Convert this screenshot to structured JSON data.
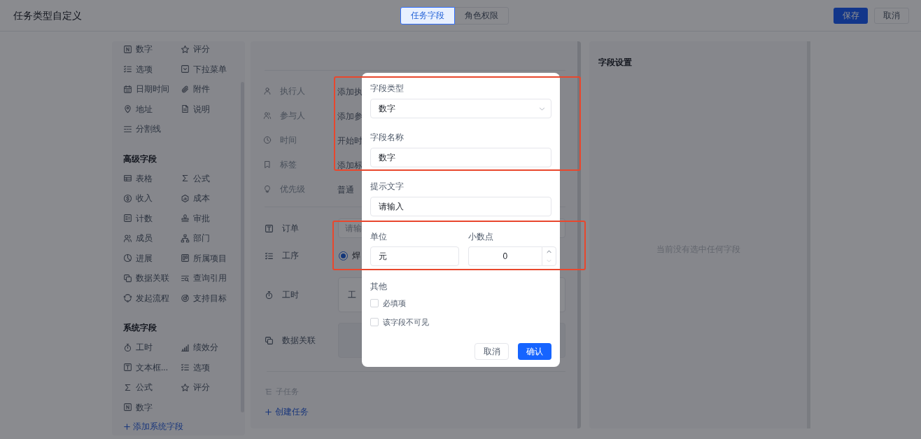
{
  "window": {
    "title": "任务类型自定义"
  },
  "tabs": [
    {
      "label": "任务字段",
      "selected": true
    },
    {
      "label": "角色权限",
      "selected": false
    }
  ],
  "header_buttons": [
    {
      "kind": "primary",
      "label": "保存"
    },
    {
      "kind": "default",
      "label": "取消"
    }
  ],
  "palette": {
    "sections": [
      {
        "items": [
          {
            "kind": "number",
            "label": "数字"
          },
          {
            "kind": "rating",
            "label": "评分"
          },
          {
            "kind": "options",
            "label": "选项"
          },
          {
            "kind": "dropdown",
            "label": "下拉菜单"
          },
          {
            "kind": "datetime",
            "label": "日期时间"
          },
          {
            "kind": "attachment",
            "label": "附件"
          },
          {
            "kind": "address",
            "label": "地址"
          },
          {
            "kind": "description",
            "label": "说明"
          },
          {
            "kind": "divider",
            "label": "分割线"
          }
        ]
      },
      {
        "heading": "高级字段",
        "items": [
          {
            "kind": "table",
            "label": "表格"
          },
          {
            "kind": "formula",
            "label": "公式"
          },
          {
            "kind": "income",
            "label": "收入"
          },
          {
            "kind": "cost",
            "label": "成本"
          },
          {
            "kind": "count",
            "label": "计数"
          },
          {
            "kind": "approval",
            "label": "审批"
          },
          {
            "kind": "member",
            "label": "成员"
          },
          {
            "kind": "department",
            "label": "部门"
          },
          {
            "kind": "progress",
            "label": "进展"
          },
          {
            "kind": "project",
            "label": "所属项目"
          },
          {
            "kind": "relation",
            "label": "数据关联"
          },
          {
            "kind": "lookup",
            "label": "查询引用"
          },
          {
            "kind": "workflow",
            "label": "发起流程"
          },
          {
            "kind": "goal",
            "label": "支持目标"
          }
        ]
      },
      {
        "heading": "系统字段",
        "items": [
          {
            "kind": "timer",
            "label": "工时"
          },
          {
            "kind": "score",
            "label": "绩效分"
          },
          {
            "kind": "textbox",
            "label": "文本框..."
          },
          {
            "kind": "options",
            "label": "选项"
          },
          {
            "kind": "formula",
            "label": "公式"
          },
          {
            "kind": "rating",
            "label": "评分"
          },
          {
            "kind": "number",
            "label": "数字"
          }
        ]
      }
    ],
    "add_link": "添加系统字段"
  },
  "task_fields": [
    {
      "kind": "assignee",
      "label": "执行人",
      "placeholder": "添加执"
    },
    {
      "kind": "participants",
      "label": "参与人",
      "placeholder": "添加参"
    },
    {
      "kind": "time",
      "label": "时间",
      "placeholder": "开始时"
    },
    {
      "kind": "tags",
      "label": "标签",
      "placeholder": "添加标"
    },
    {
      "kind": "priority",
      "label": "优先级",
      "value": "普通"
    }
  ],
  "custom_fields": [
    {
      "kind": "text",
      "label": "订单",
      "placeholder": "请输"
    },
    {
      "kind": "options",
      "label": "工序",
      "options": [
        {
          "label": "焊",
          "selected": true
        }
      ]
    },
    {
      "kind": "timer",
      "label": "工时",
      "value": "工"
    },
    {
      "kind": "relation",
      "label": "数据关联"
    }
  ],
  "subtasks": {
    "heading": "子任务",
    "create_link": "创建任务"
  },
  "dialog": {
    "fields": [
      {
        "kind": "select",
        "label": "字段类型",
        "value": "数字"
      },
      {
        "kind": "text",
        "label": "字段名称",
        "value": "数字"
      },
      {
        "kind": "text",
        "label": "提示文字",
        "value": "请输入"
      }
    ],
    "inline_fields": [
      {
        "kind": "text",
        "label": "单位",
        "value": "元"
      },
      {
        "kind": "number",
        "label": "小数点",
        "value": "0"
      }
    ],
    "other": {
      "label": "其他",
      "checkboxes": [
        {
          "label": "必填项",
          "checked": false
        },
        {
          "label": "该字段不可见",
          "checked": false
        }
      ]
    },
    "buttons": [
      {
        "kind": "default",
        "label": "取消"
      },
      {
        "kind": "primary",
        "label": "确认"
      }
    ]
  },
  "field_settings": {
    "title": "字段设置",
    "empty_text": "当前没有选中任何字段"
  }
}
